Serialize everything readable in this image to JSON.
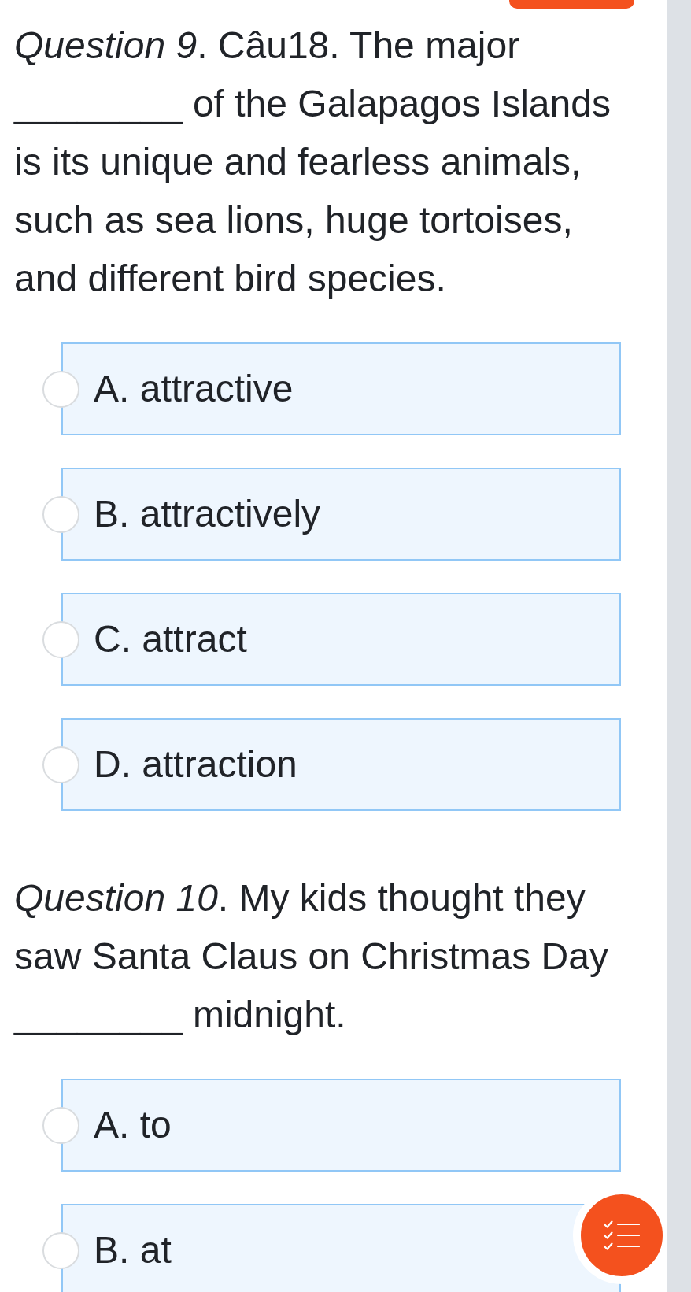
{
  "questions": [
    {
      "prompt_before": "*Question 9*. Câu18. The major",
      "blank": "________",
      "prompt_after": "of the Galapagos Islands is its unique and fearless animals, such as sea lions, huge tortoises, and different bird species.",
      "options": [
        {
          "label": "A. attractive",
          "selected": false
        },
        {
          "label": "B. attractively",
          "selected": false
        },
        {
          "label": "C. attract",
          "selected": false
        },
        {
          "label": "D. attraction",
          "selected": false
        }
      ]
    },
    {
      "prompt_before": "*Question 10*. My kids thought they saw Santa Claus on Christmas Day",
      "blank": "________",
      "prompt_after": "midnight.",
      "options": [
        {
          "label": "A. to",
          "selected": false
        },
        {
          "label": "B. at",
          "selected": false
        }
      ]
    }
  ]
}
